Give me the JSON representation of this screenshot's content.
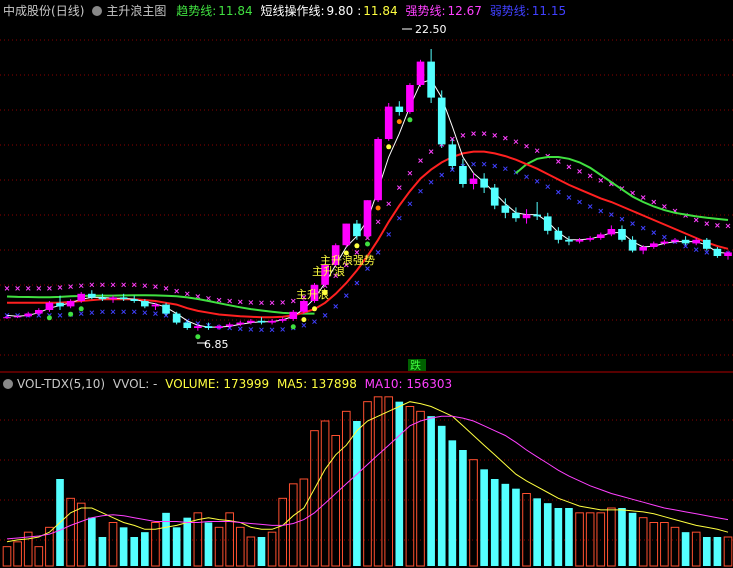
{
  "header": {
    "stock": "中成股份",
    "period": "(日线)",
    "indicator": "主升浪主图",
    "trend_label": "趋势线:",
    "trend_value": "11.84",
    "short_label": "短线操作线:",
    "short_value": "9.80",
    "sep": ":",
    "short_value2": "11.84",
    "strong_label": "强势线:",
    "strong_value": "12.67",
    "weak_label": "弱势线:",
    "weak_value": "11.15"
  },
  "vol_header": {
    "name": "VOL-TDX(5,10)",
    "vvol": "VVOL: -",
    "volume": "VOLUME: 173999",
    "ma5": "MA5: 137898",
    "ma10": "MA10: 156303"
  },
  "annotations": {
    "high": "22.50",
    "low": "6.85",
    "rise1": "主升浪",
    "rise2": "主升浪",
    "rise3": "主升浪强势",
    "fall": "跌"
  },
  "colors": {
    "background": "#000000",
    "up_candle": "#ff00ff",
    "down_candle": "#54ffff",
    "trend_line": "#ff2020",
    "green_line": "#40e040",
    "strong_cross": "#ff40ff",
    "weak_cross": "#4040ff",
    "grid": "#8b0000",
    "vol_up": "#ff5030",
    "vol_down": "#54ffff",
    "ma5": "#ffff40",
    "ma10": "#ff40ff"
  },
  "chart_data": [
    {
      "type": "candlestick",
      "title": "主升浪主图",
      "ylim": [
        5.5,
        24.0
      ],
      "grid": true,
      "candles": [
        [
          7.6,
          7.7,
          7.5,
          7.6
        ],
        [
          7.6,
          7.7,
          7.55,
          7.65
        ],
        [
          7.65,
          7.9,
          7.6,
          7.8
        ],
        [
          7.8,
          8.1,
          7.7,
          8.0
        ],
        [
          8.0,
          8.5,
          7.9,
          8.4
        ],
        [
          8.4,
          8.8,
          8.0,
          8.2
        ],
        [
          8.2,
          8.6,
          8.1,
          8.5
        ],
        [
          8.5,
          9.0,
          8.4,
          8.9
        ],
        [
          8.9,
          9.1,
          8.6,
          8.7
        ],
        [
          8.7,
          8.9,
          8.5,
          8.6
        ],
        [
          8.6,
          8.8,
          8.4,
          8.7
        ],
        [
          8.7,
          8.9,
          8.5,
          8.6
        ],
        [
          8.6,
          8.8,
          8.4,
          8.5
        ],
        [
          8.5,
          8.6,
          8.1,
          8.2
        ],
        [
          8.2,
          8.4,
          8.0,
          8.3
        ],
        [
          8.3,
          8.4,
          7.7,
          7.8
        ],
        [
          7.8,
          7.9,
          7.2,
          7.3
        ],
        [
          7.3,
          7.4,
          6.9,
          7.0
        ],
        [
          7.0,
          7.2,
          6.85,
          7.1
        ],
        [
          7.1,
          7.3,
          6.9,
          7.0
        ],
        [
          7.0,
          7.2,
          6.9,
          7.1
        ],
        [
          7.1,
          7.3,
          7.0,
          7.2
        ],
        [
          7.2,
          7.4,
          7.1,
          7.3
        ],
        [
          7.3,
          7.5,
          7.2,
          7.4
        ],
        [
          7.4,
          7.6,
          7.2,
          7.3
        ],
        [
          7.3,
          7.5,
          7.2,
          7.4
        ],
        [
          7.4,
          7.6,
          7.3,
          7.5
        ],
        [
          7.5,
          8.0,
          7.4,
          7.9
        ],
        [
          7.9,
          8.6,
          7.8,
          8.5
        ],
        [
          8.5,
          9.5,
          8.4,
          9.4
        ],
        [
          9.4,
          10.6,
          9.3,
          10.5
        ],
        [
          10.5,
          11.7,
          10.4,
          11.6
        ],
        [
          11.6,
          12.8,
          11.5,
          12.8
        ],
        [
          12.8,
          13.0,
          11.9,
          12.1
        ],
        [
          12.1,
          14.1,
          12.0,
          14.1
        ],
        [
          14.1,
          17.6,
          14.0,
          17.5
        ],
        [
          17.5,
          19.5,
          17.4,
          19.3
        ],
        [
          19.3,
          19.6,
          18.8,
          19.0
        ],
        [
          19.0,
          20.6,
          18.9,
          20.5
        ],
        [
          20.5,
          21.9,
          20.4,
          21.8
        ],
        [
          21.8,
          22.5,
          19.5,
          19.8
        ],
        [
          19.8,
          20.2,
          17.0,
          17.2
        ],
        [
          17.2,
          17.5,
          15.8,
          16.0
        ],
        [
          16.0,
          16.4,
          14.8,
          15.0
        ],
        [
          15.0,
          15.6,
          14.7,
          15.3
        ],
        [
          15.3,
          15.6,
          14.5,
          14.8
        ],
        [
          14.8,
          15.0,
          13.6,
          13.8
        ],
        [
          13.8,
          14.2,
          13.1,
          13.4
        ],
        [
          13.4,
          13.7,
          12.9,
          13.1
        ],
        [
          13.1,
          13.6,
          12.8,
          13.3
        ],
        [
          13.3,
          14.0,
          13.0,
          13.2
        ],
        [
          13.2,
          13.4,
          12.2,
          12.4
        ],
        [
          12.4,
          12.6,
          11.7,
          11.9
        ],
        [
          11.9,
          12.1,
          11.6,
          11.8
        ],
        [
          11.8,
          12.0,
          11.7,
          11.9
        ],
        [
          11.9,
          12.1,
          11.8,
          12.0
        ],
        [
          12.0,
          12.3,
          11.9,
          12.2
        ],
        [
          12.2,
          12.7,
          12.1,
          12.5
        ],
        [
          12.5,
          12.7,
          11.8,
          11.9
        ],
        [
          11.9,
          12.1,
          11.2,
          11.3
        ],
        [
          11.3,
          11.6,
          11.1,
          11.5
        ],
        [
          11.5,
          11.8,
          11.4,
          11.7
        ],
        [
          11.7,
          11.9,
          11.6,
          11.8
        ],
        [
          11.8,
          12.0,
          11.7,
          11.9
        ],
        [
          11.9,
          12.1,
          11.6,
          11.7
        ],
        [
          11.7,
          12.0,
          11.6,
          11.9
        ],
        [
          11.9,
          12.0,
          11.3,
          11.4
        ],
        [
          11.4,
          11.5,
          10.9,
          11.0
        ],
        [
          11.0,
          11.3,
          10.8,
          11.2
        ]
      ],
      "trend_line": [
        8.4,
        8.4,
        8.4,
        8.4,
        8.4,
        8.4,
        8.45,
        8.5,
        8.55,
        8.6,
        8.6,
        8.6,
        8.6,
        8.55,
        8.5,
        8.4,
        8.3,
        8.1,
        7.95,
        7.85,
        7.75,
        7.7,
        7.65,
        7.62,
        7.6,
        7.6,
        7.62,
        7.7,
        7.85,
        8.05,
        8.4,
        8.9,
        9.5,
        10.2,
        11.0,
        11.9,
        12.9,
        13.8,
        14.6,
        15.3,
        15.8,
        16.2,
        16.5,
        16.7,
        16.8,
        16.8,
        16.7,
        16.55,
        16.35,
        16.1,
        15.85,
        15.55,
        15.25,
        14.95,
        14.7,
        14.45,
        14.2,
        14.0,
        13.75,
        13.5,
        13.25,
        13.0,
        12.75,
        12.5,
        12.25,
        12.0,
        11.75,
        11.55,
        11.4
      ],
      "green_line": [
        8.75,
        8.73,
        8.72,
        8.71,
        8.71,
        8.73,
        8.76,
        8.78,
        8.8,
        8.8,
        8.8,
        8.81,
        8.82,
        8.82,
        8.81,
        8.79,
        8.76,
        8.7,
        8.61,
        8.5,
        8.38,
        8.26,
        8.15,
        8.05,
        7.97,
        7.9,
        7.84,
        7.81,
        7.8,
        7.8,
        null,
        null,
        null,
        null,
        null,
        null,
        null,
        null,
        null,
        null,
        null,
        null,
        null,
        null,
        null,
        null,
        null,
        null,
        15.6,
        16.1,
        16.4,
        16.5,
        16.5,
        16.4,
        16.2,
        15.9,
        15.5,
        15.1,
        14.7,
        14.3,
        14.0,
        13.75,
        13.55,
        13.4,
        13.3,
        13.2,
        13.12,
        13.06,
        13.0,
        12.95,
        12.92,
        12.9,
        12.88,
        12.85,
        12.82,
        12.8,
        12.78,
        12.76,
        12.74,
        12.72,
        12.7,
        12.68,
        12.66,
        12.64,
        12.62,
        12.6
      ],
      "strong_line": [
        9.2,
        9.2,
        9.2,
        9.2,
        9.2,
        9.25,
        9.3,
        9.35,
        9.4,
        9.4,
        9.4,
        9.4,
        9.4,
        9.35,
        9.3,
        9.2,
        9.05,
        8.9,
        8.75,
        8.65,
        8.55,
        8.5,
        8.45,
        8.42,
        8.4,
        8.4,
        8.42,
        8.5,
        8.7,
        8.95,
        9.35,
        9.9,
        10.5,
        11.2,
        12.0,
        12.9,
        13.9,
        14.8,
        15.6,
        16.3,
        16.8,
        17.2,
        17.5,
        17.7,
        17.8,
        17.8,
        17.7,
        17.55,
        17.35,
        17.1,
        16.85,
        16.55,
        16.25,
        15.95,
        15.7,
        15.45,
        15.2,
        15.0,
        14.75,
        14.5,
        14.25,
        14.0,
        13.75,
        13.5,
        13.25,
        13.0,
        12.8,
        12.7,
        12.67
      ],
      "weak_line": [
        7.7,
        7.7,
        7.7,
        7.7,
        7.7,
        7.7,
        7.75,
        7.8,
        7.85,
        7.9,
        7.9,
        7.9,
        7.9,
        7.85,
        7.8,
        7.7,
        7.6,
        7.4,
        7.25,
        7.15,
        7.05,
        7.0,
        6.95,
        6.92,
        6.9,
        6.9,
        6.92,
        7.0,
        7.15,
        7.35,
        7.7,
        8.2,
        8.8,
        9.5,
        10.3,
        11.2,
        12.2,
        13.1,
        13.9,
        14.6,
        15.1,
        15.5,
        15.8,
        16.0,
        16.1,
        16.1,
        16.0,
        15.85,
        15.65,
        15.4,
        15.15,
        14.85,
        14.55,
        14.25,
        14.0,
        13.75,
        13.5,
        13.3,
        13.05,
        12.8,
        12.55,
        12.3,
        12.05,
        11.8,
        11.55,
        11.35,
        11.2,
        11.15,
        11.15
      ],
      "short_line": [
        7.7,
        7.65,
        7.7,
        7.85,
        8.1,
        8.25,
        8.4,
        8.6,
        8.7,
        8.7,
        8.65,
        8.65,
        8.6,
        8.45,
        8.35,
        8.15,
        7.8,
        7.4,
        7.15,
        7.05,
        7.05,
        7.1,
        7.2,
        7.3,
        7.35,
        7.35,
        7.45,
        7.65,
        8.05,
        8.65,
        9.5,
        10.5,
        11.5,
        12.1,
        13.0,
        14.7,
        16.5,
        17.8,
        19.3,
        20.6,
        20.8,
        19.8,
        18.2,
        16.5,
        15.6,
        15.1,
        14.5,
        13.9,
        13.4,
        13.3,
        13.3,
        12.9,
        12.3,
        11.9,
        11.9,
        11.95,
        12.1,
        12.3,
        12.3,
        11.8,
        11.5,
        11.55,
        11.7,
        11.8,
        11.8,
        11.8,
        11.6,
        11.2,
        11.15
      ]
    },
    {
      "type": "bar",
      "title": "VOL-TDX(5,10)",
      "series": [
        {
          "name": "VOLUME",
          "values": [
            20,
            25,
            35,
            20,
            40,
            90,
            70,
            65,
            50,
            30,
            45,
            40,
            30,
            35,
            45,
            55,
            40,
            50,
            55,
            45,
            40,
            55,
            40,
            30,
            30,
            35,
            70,
            85,
            90,
            140,
            150,
            135,
            160,
            150,
            170,
            175,
            175,
            170,
            165,
            160,
            155,
            145,
            130,
            120,
            110,
            100,
            90,
            85,
            80,
            75,
            70,
            65,
            60,
            60,
            55,
            55,
            55,
            60,
            60,
            55,
            50,
            45,
            45,
            40,
            35,
            35,
            30,
            30,
            30
          ]
        },
        {
          "name": "MA5",
          "values": [
            25,
            27,
            28,
            30,
            35,
            45,
            55,
            60,
            60,
            55,
            50,
            45,
            42,
            38,
            38,
            40,
            42,
            45,
            48,
            50,
            48,
            47,
            45,
            40,
            38,
            38,
            42,
            52,
            60,
            80,
            100,
            115,
            125,
            140,
            150,
            155,
            160,
            165,
            170,
            168,
            165,
            160,
            155,
            145,
            135,
            125,
            115,
            105,
            95,
            88,
            82,
            76,
            70,
            66,
            62,
            60,
            58,
            58,
            58,
            57,
            56,
            54,
            51,
            48,
            45,
            42,
            40,
            38,
            35
          ]
        },
        {
          "name": "MA10",
          "values": [
            28,
            29,
            30,
            31,
            33,
            37,
            42,
            46,
            50,
            52,
            53,
            52,
            50,
            48,
            46,
            46,
            46,
            45,
            45,
            46,
            46,
            46,
            45,
            44,
            43,
            42,
            42,
            44,
            48,
            55,
            65,
            75,
            85,
            95,
            105,
            115,
            125,
            135,
            145,
            150,
            153,
            155,
            155,
            153,
            150,
            145,
            140,
            135,
            128,
            120,
            113,
            106,
            99,
            93,
            88,
            83,
            79,
            75,
            72,
            69,
            66,
            63,
            60,
            58,
            56,
            54,
            52,
            50,
            48
          ]
        }
      ]
    }
  ]
}
